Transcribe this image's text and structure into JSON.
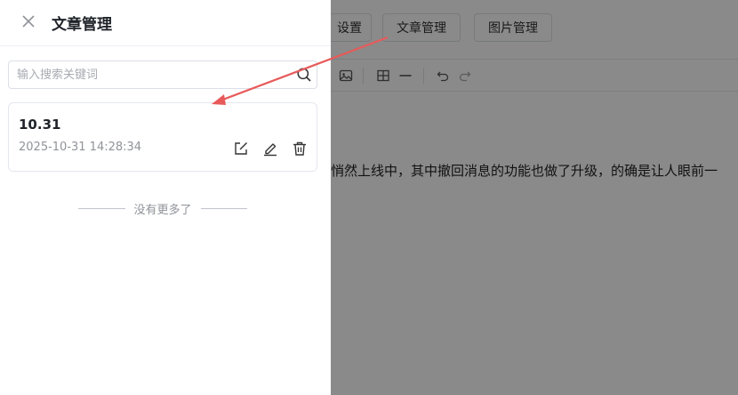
{
  "editor": {
    "buttons": {
      "settings": "设置",
      "articles": "文章管理",
      "images": "图片管理"
    },
    "content_text": "悄然上线中，其中撤回消息的功能也做了升级，的确是让人眼前一"
  },
  "drawer": {
    "title": "文章管理",
    "search": {
      "placeholder": "输入搜索关键词",
      "value": ""
    },
    "articles": [
      {
        "title": "10.31",
        "date": "2025-10-31 14:28:34"
      }
    ],
    "end_text": "没有更多了"
  },
  "colors": {
    "annotation_arrow": "#e85a5a",
    "overlay": "rgba(0,0,0,0.46)"
  }
}
